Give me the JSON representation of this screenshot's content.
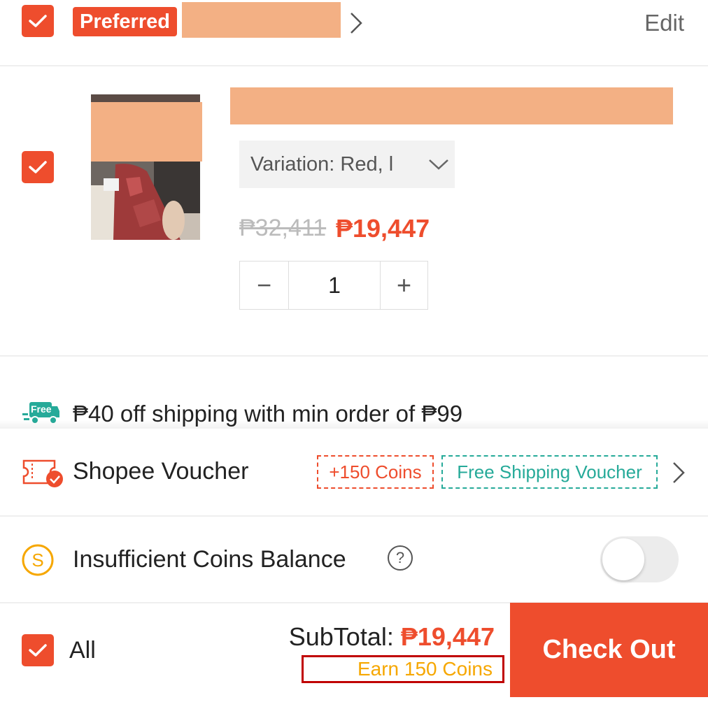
{
  "shop": {
    "badge_label": "Preferred",
    "edit_label": "Edit"
  },
  "product": {
    "variation_label": "Variation: Red, l",
    "original_price": "₱32,411",
    "sale_price": "₱19,447",
    "quantity": "1",
    "minus_symbol": "−",
    "plus_symbol": "+"
  },
  "shipping": {
    "icon_label": "Free",
    "text": "₱40 off shipping with min order of ₱99"
  },
  "voucher": {
    "label": "Shopee Voucher",
    "coins_chip": "+150 Coins",
    "shipping_chip": "Free Shipping Voucher"
  },
  "coins": {
    "label": "Insufficient Coins Balance",
    "help_symbol": "?",
    "toggle_on": false
  },
  "footer": {
    "select_all_label": "All",
    "subtotal_label": "SubTotal:",
    "subtotal_value": "₱19,447",
    "earn_coins": "Earn 150 Coins",
    "checkout_label": "Check Out"
  },
  "colors": {
    "accent": "#ee4d2d",
    "teal": "#26aa99",
    "coin_gold": "#f6a700",
    "redaction": "#f3b084"
  }
}
